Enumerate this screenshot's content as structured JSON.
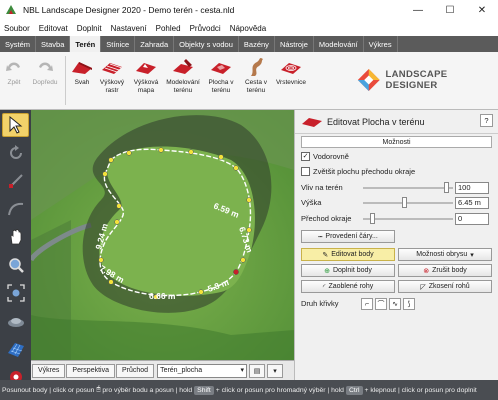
{
  "window": {
    "title": "NBL Landscape Designer 2020 - Demo terén - cesta.nld",
    "minimize": "—",
    "maximize": "☐",
    "close": "✕"
  },
  "menu": [
    "Soubor",
    "Editovat",
    "Doplnit",
    "Nastavení",
    "Pohled",
    "Průvodci",
    "Nápověda"
  ],
  "tabs": [
    {
      "label": "Systém"
    },
    {
      "label": "Stavba"
    },
    {
      "label": "Terén",
      "active": true
    },
    {
      "label": "Stínice"
    },
    {
      "label": "Zahrada"
    },
    {
      "label": "Objekty s vodou"
    },
    {
      "label": "Bazény"
    },
    {
      "label": "Nástroje"
    },
    {
      "label": "Modelování"
    },
    {
      "label": "Výkres"
    }
  ],
  "ribbon": {
    "back": "Zpět",
    "forward": "Dopředu",
    "slope": "Svah",
    "height_raster": "Výškový rastr",
    "height_map": "Výšková mapa",
    "terrain_modeling": "Modelování terénu",
    "terrain_area": "Plocha v terénu",
    "terrain_path": "Cesta v terénu",
    "contours": "Vrstevnice"
  },
  "logo_text": "LANDSCAPE DESIGNER",
  "viewport": {
    "measurements": [
      "6.59 m",
      "6.73 m",
      "5.8 m",
      "6.66 m",
      "7.98 m",
      "9.24 m"
    ]
  },
  "view_tabs": [
    "Výkres",
    "Perspektiva",
    "Průchod"
  ],
  "view_select": "Terén_plocha",
  "panel": {
    "title": "Editovat Plocha v terénu",
    "help": "?",
    "section": "Možnosti",
    "horizontal_label": "Vodorovně",
    "horizontal_checked": true,
    "enlarge_label": "Zvětšit plochu přechodu okraje",
    "enlarge_checked": false,
    "influence_label": "Vliv na terén",
    "influence_value": "100",
    "influence_level": 0.92,
    "height_label": "Výška",
    "height_value": "6.45 m",
    "height_level": 0.45,
    "transition_label": "Přechod okraje",
    "transition_value": "0",
    "transition_level": 0.1,
    "line_style_button": "Provedení čáry...",
    "edit_points_button": "Editovat body",
    "outline_options_button": "Možnosti obrysu",
    "add_points_button": "Doplnit body",
    "cancel_points_button": "Zrušit body",
    "round_corners_button": "Zaoblené rohy",
    "bevel_corners_button": "Zkosení rohů",
    "curve_type_label": "Druh křivky"
  },
  "status": {
    "t1": "Posunout body",
    "t2": "click or posun",
    "t3": "pro výběr bodu a posun",
    "t4": "hold",
    "k1": "Shift",
    "t5": "+ click or posun",
    "t6": "pro hromadný výběr",
    "t7": "hold",
    "k2": "Ctrl",
    "t8": "+ klepnout",
    "t9": "click or posun",
    "t10": "pro doplnit"
  },
  "colors": {
    "accent_red": "#c8202a",
    "active_tab_bg": "#f0f0f0",
    "grass": "#5f9a3c",
    "point_yellow": "#f3e23a"
  }
}
